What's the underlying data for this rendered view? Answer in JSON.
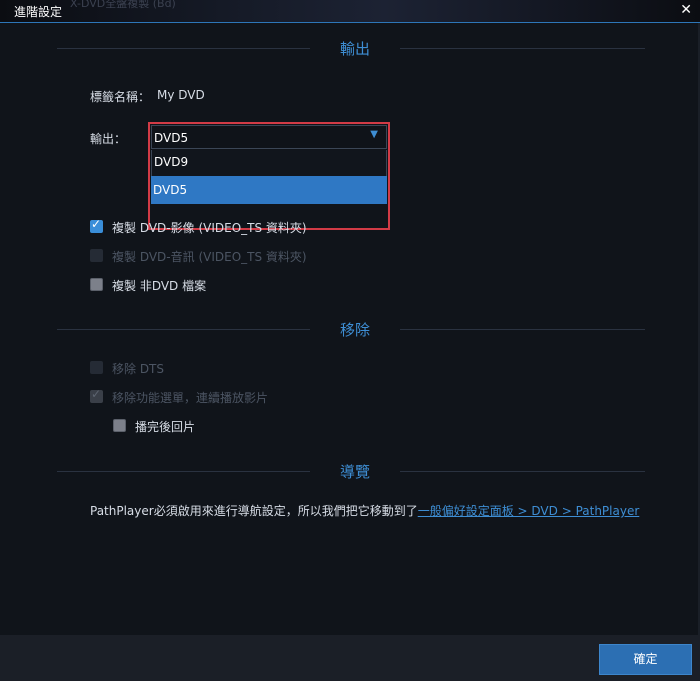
{
  "window": {
    "title": "進階設定",
    "ghost_title": "X-DVD全盤複製 (Bd)",
    "close_icon": "✕"
  },
  "sections": {
    "output": "輸出",
    "remove": "移除",
    "navigation": "導覽"
  },
  "output": {
    "label_name_label": "標籤名稱：",
    "label_name_value": "My DVD",
    "output_label": "輸出：",
    "select_value": "DVD5",
    "options": [
      "DVD9",
      "DVD5"
    ],
    "selected_option": "DVD5"
  },
  "copy_options": [
    {
      "label": "複製 DVD-影像 (VIDEO_TS 資料夾)",
      "state": "checked"
    },
    {
      "label": "複製 DVD-音訊 (VIDEO_TS 資料夾)",
      "state": "disabled"
    },
    {
      "label": "複製 非DVD 檔案",
      "state": "unchecked"
    }
  ],
  "remove_options": [
    {
      "label": "移除 DTS",
      "state": "disabled"
    },
    {
      "label": "移除功能選單，連續播放影片",
      "state": "disabled-checked"
    },
    {
      "label": "播完後回片",
      "state": "unchecked"
    }
  ],
  "navigation": {
    "text": "PathPlayer必須啟用來進行導航設定，所以我們把它移動到了",
    "link": "一般偏好設定面板 > DVD > PathPlayer"
  },
  "footer": {
    "ok_label": "確定"
  },
  "colors": {
    "accent": "#3e8ed4",
    "highlight_box": "#d23b46",
    "selected_option_bg": "#2f78c4",
    "button_bg": "#2c6fb3"
  }
}
